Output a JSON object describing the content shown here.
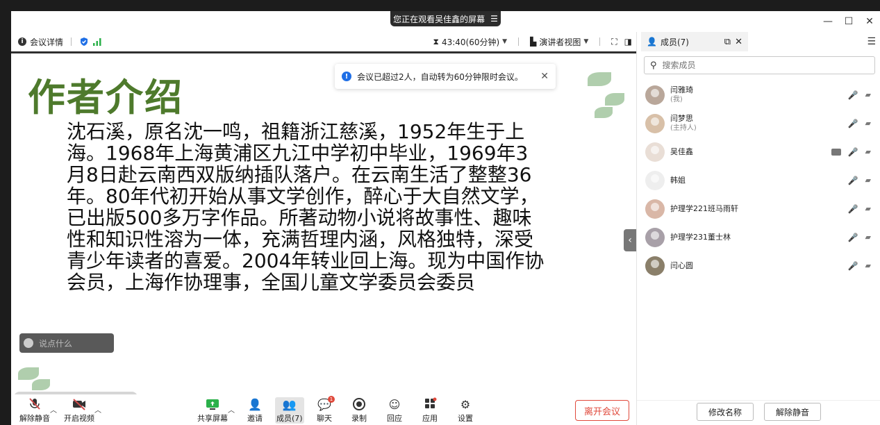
{
  "share_banner": {
    "text": "您正在观看吴佳鑫的屏幕",
    "menu_glyph": "☰"
  },
  "window_controls": {
    "minimize": "—",
    "maximize": "☐",
    "close": "✕"
  },
  "toolbar": {
    "meeting_info_label": "会议详情",
    "timer": "43:40(60分钟)",
    "view_label": "演讲者视图"
  },
  "slide": {
    "title": "作者介绍",
    "body": "沈石溪，原名沈一鸣，祖籍浙江慈溪，1952年生于上海。1968年上海黄浦区九江中学初中毕业，1969年3月8日赴云南西双版纳插队落户。在云南生活了整整36年。80年代初开始从事文学创作，醉心于大自然文学，已出版500多万字作品。所著动物小说将故事性、趣味性和知识性溶为一体，充满哲理内涵，风格独特，深受青少年读者的喜爱。2004年转业回上海。现为中国作协会员，上海作协理事，全国儿童文学委员会委员"
  },
  "notice": {
    "text": "会议已超过2人，自动转为60分钟限时会议。",
    "close": "✕"
  },
  "chat_input": {
    "placeholder": "说点什么"
  },
  "bottombar": {
    "unmute": "解除静音",
    "start_video": "开启视频",
    "share_screen": "共享屏幕",
    "invite": "邀请",
    "members": "成员(7)",
    "chat": "聊天",
    "chat_badge": "1",
    "record": "录制",
    "reaction": "回应",
    "apps": "应用",
    "settings": "设置",
    "leave": "离开会议"
  },
  "panel": {
    "tab_label": "成员(7)",
    "search_placeholder": "搜索成员",
    "members": [
      {
        "name": "闫雅琦",
        "sub": "(我)",
        "mic": "off"
      },
      {
        "name": "闫梦思",
        "sub": "(主持人)",
        "mic": "gray"
      },
      {
        "name": "吴佳鑫",
        "sub": "",
        "mic": "on"
      },
      {
        "name": "韩姐",
        "sub": "",
        "mic": "off"
      },
      {
        "name": "护理学221班马雨轩",
        "sub": "",
        "mic": "off"
      },
      {
        "name": "护理学231董士林",
        "sub": "",
        "mic": "off"
      },
      {
        "name": "闫心圆",
        "sub": "",
        "mic": "off"
      }
    ],
    "rename_button": "修改名称",
    "unmute_button": "解除静音"
  },
  "colors": {
    "accent_green": "#4e7a2c",
    "leave_red": "#e0493b",
    "info_blue": "#1f6fe6"
  }
}
